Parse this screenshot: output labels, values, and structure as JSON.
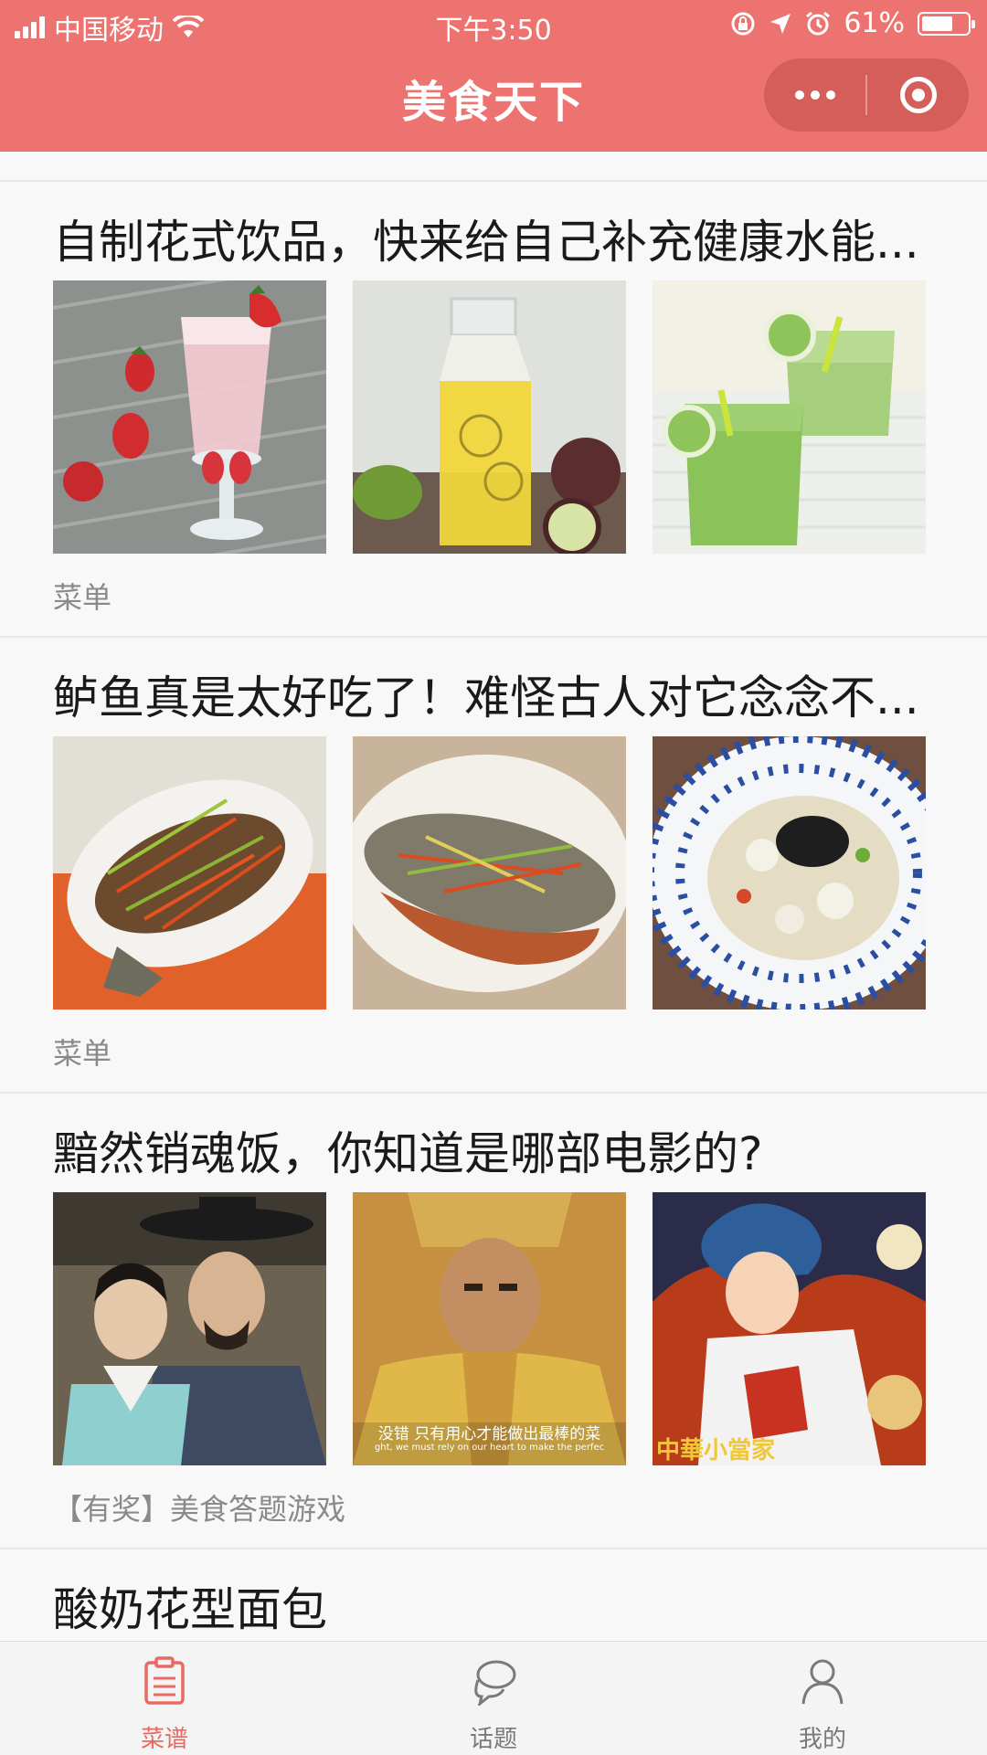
{
  "status_bar": {
    "carrier": "中国移动",
    "time": "下午3:50",
    "battery_text": "61%",
    "battery_level": 0.61
  },
  "nav": {
    "title": "美食天下"
  },
  "feed": [
    {
      "title": "自制花式饮品，快来给自己补充健康水能...",
      "tag": "菜单",
      "thumbs": [
        "strawberry-smoothie-photo",
        "passion-fruit-drink-photo",
        "green-cucumber-juice-photo"
      ]
    },
    {
      "title": "鲈鱼真是太好吃了！难怪古人对它念念不...",
      "tag": "菜单",
      "thumbs": [
        "steamed-fish-carrot-photo",
        "steamed-sea-bass-photo",
        "fish-stew-bowl-photo"
      ]
    },
    {
      "title": "黯然销魂饭，你知道是哪部电影的?",
      "tag": "【有奖】美食答题游戏",
      "thumbs": [
        "korean-drama-still-photo",
        "movie-still-photo",
        "anime-chef-photo"
      ],
      "captions": {
        "movie_cn": "没错 只有用心才能做出最棒的菜",
        "movie_en": "ght, we must rely on our heart to make the perfec",
        "anime": "中華小當家"
      }
    },
    {
      "title": "酸奶花型面包"
    }
  ],
  "tabbar": {
    "items": [
      {
        "label": "菜谱",
        "icon": "clipboard-icon",
        "active": true
      },
      {
        "label": "话题",
        "icon": "chat-bubbles-icon",
        "active": false
      },
      {
        "label": "我的",
        "icon": "person-icon",
        "active": false
      }
    ],
    "active_color": "#e96a63",
    "inactive_color": "#7a7a7a"
  },
  "colors": {
    "nav_bg": "#ed7370"
  }
}
